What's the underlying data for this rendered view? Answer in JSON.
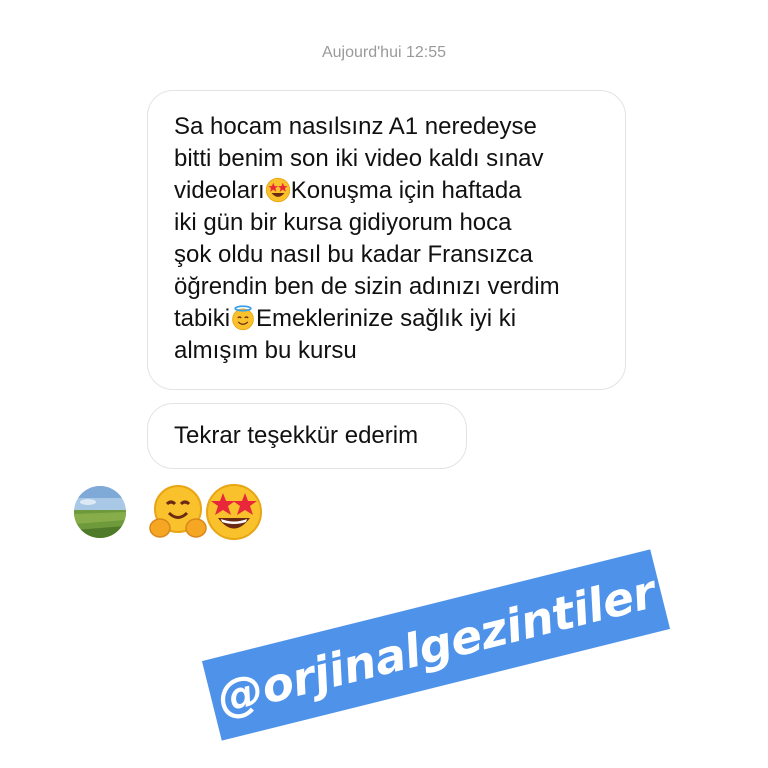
{
  "timestamp": "Aujourd'hui 12:55",
  "messages": [
    {
      "lines": [
        "Sa hocam nasılsınz A1 neredeyse",
        "bitti benim son iki video kaldı sınav",
        "videoları",
        "Konuşma için haftada",
        "iki gün bir kursa gidiyorum hoca",
        "şok oldu nasıl bu kadar Fransızca",
        "öğrendin ben de sizin adınızı verdim",
        "tabiki",
        "Emeklerinize sağlık iyi ki",
        "almışım bu kursu"
      ]
    },
    {
      "text": "Tekrar teşekkür ederim"
    }
  ],
  "reactions": {
    "icons": [
      "hugging-face-icon",
      "star-struck-icon"
    ]
  },
  "sticker": {
    "handle": "@orjinalgezintiler",
    "color": "#4e92ea"
  }
}
